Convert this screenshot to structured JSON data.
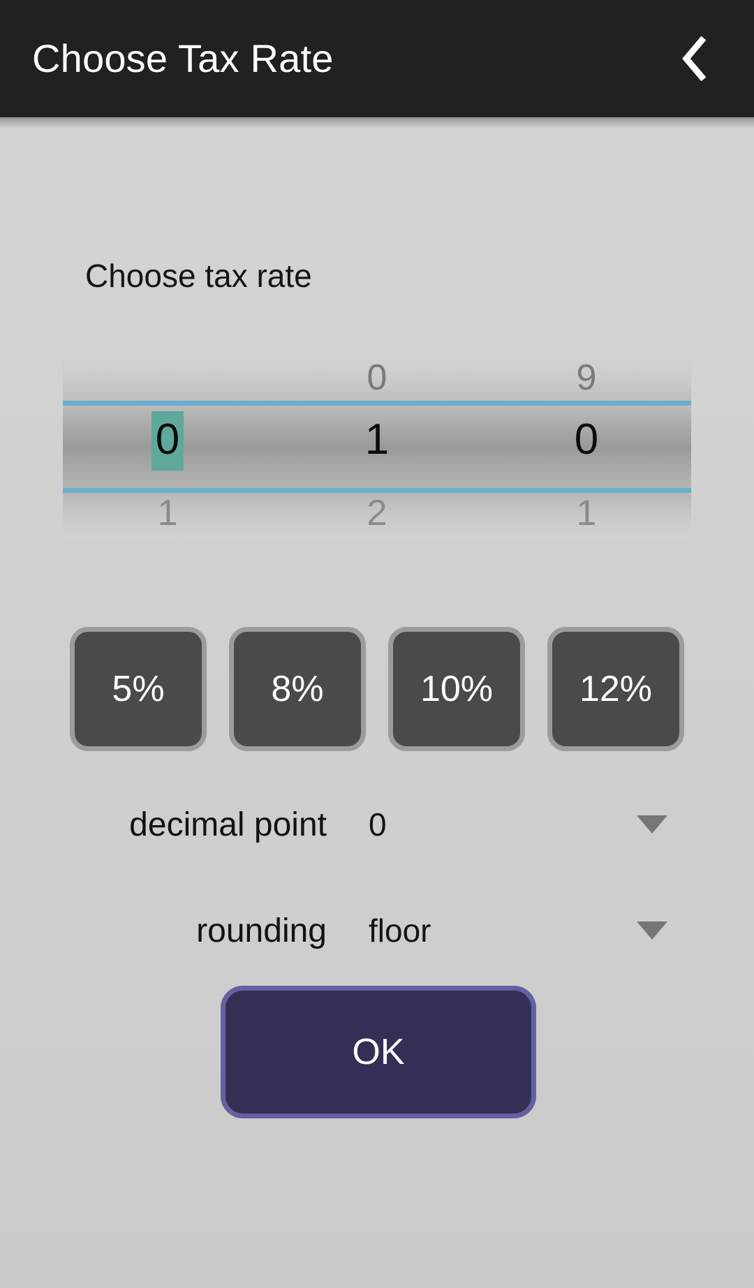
{
  "appbar": {
    "title": "Choose Tax Rate",
    "back_icon": "chevron-left-icon"
  },
  "main": {
    "section_label": "Choose tax rate",
    "picker": {
      "columns": [
        {
          "prev": "",
          "selected": "0",
          "next": "1",
          "highlighted": true
        },
        {
          "prev": "0",
          "selected": "1",
          "next": "2",
          "highlighted": false
        },
        {
          "prev": "9",
          "selected": "0",
          "next": "1",
          "highlighted": false
        }
      ],
      "divider_color": "#6aafd0",
      "highlight_color": "#5fa89c"
    },
    "presets": [
      {
        "label": "5%"
      },
      {
        "label": "8%"
      },
      {
        "label": "10%"
      },
      {
        "label": "12%"
      }
    ],
    "options": [
      {
        "label": "decimal point",
        "value": "0",
        "caret_icon": "chevron-down-icon"
      },
      {
        "label": "rounding",
        "value": "floor",
        "caret_icon": "chevron-down-icon"
      }
    ],
    "ok_button": {
      "label": "OK",
      "fill": "#332f55",
      "border": "#6561a0"
    }
  }
}
